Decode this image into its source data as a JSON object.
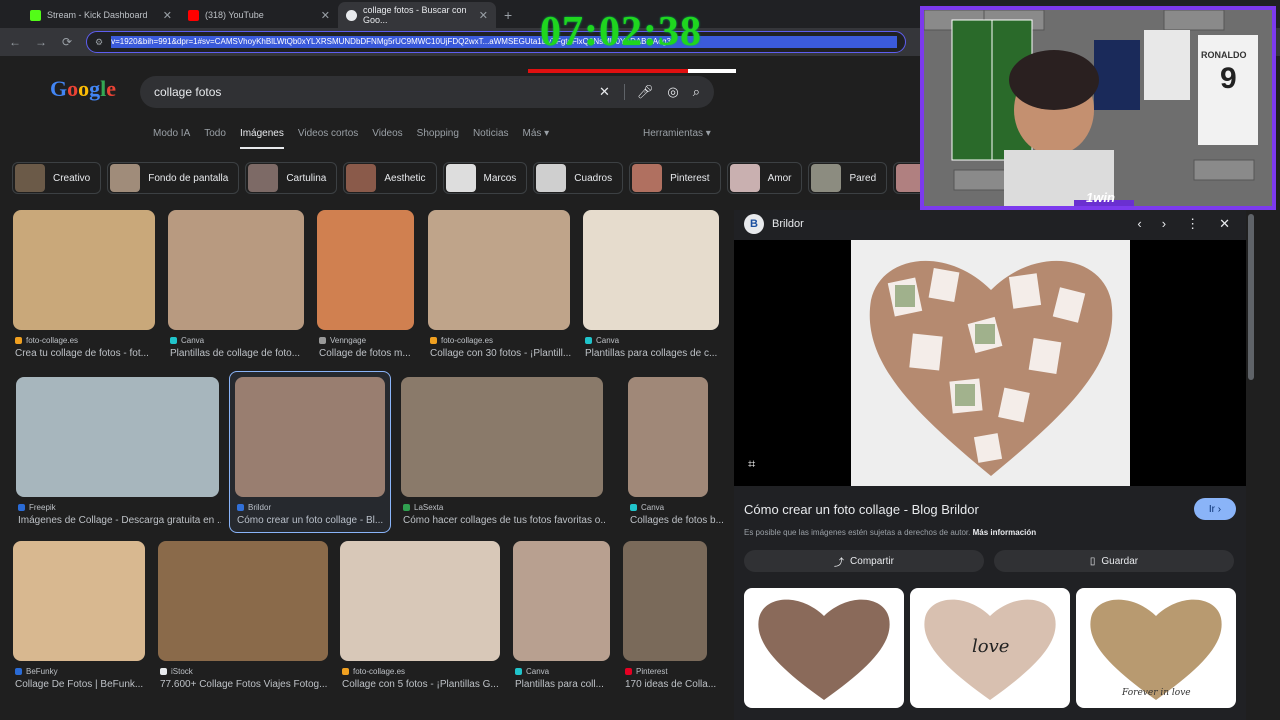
{
  "browser": {
    "tabs": [
      {
        "title": "Stream - Kick Dashboard",
        "favicon_color": "#53fc18"
      },
      {
        "title": "(318) YouTube",
        "favicon_color": "#ff0000"
      },
      {
        "title": "collage fotos - Buscar con Goo...",
        "favicon_color": "#e8eaed"
      }
    ],
    "url": "v=1920&bih=991&dpr=1#sv=CAMSVhoyKhBlLWtQb0xYLXRSMUNDbDFNMg5rUC9MWC10UjFDQ2wxT...aWMSEGUta1BvTFgtdFlxQ0NsMU0YADABGAcg3"
  },
  "overlay": {
    "timer": "07:02:38",
    "progress": 0.77
  },
  "search": {
    "logo": "Google",
    "query": "collage fotos"
  },
  "nav": {
    "tabs": [
      "Modo IA",
      "Todo",
      "Imágenes",
      "Videos cortos",
      "Videos",
      "Shopping",
      "Noticias",
      "Más ▾"
    ],
    "tools": "Herramientas ▾"
  },
  "chips": [
    {
      "label": "Creativo",
      "color": "#6b5a48"
    },
    {
      "label": "Fondo de pantalla",
      "color": "#a08c7a"
    },
    {
      "label": "Cartulina",
      "color": "#7d6a66"
    },
    {
      "label": "Aesthetic",
      "color": "#8a5a4a"
    },
    {
      "label": "Marcos",
      "color": "#dddddd"
    },
    {
      "label": "Cuadros",
      "color": "#cfcfcf"
    },
    {
      "label": "Pinterest",
      "color": "#b07060"
    },
    {
      "label": "Amor",
      "color": "#c9b0b0"
    },
    {
      "label": "Pared",
      "color": "#8c8c80"
    },
    {
      "label": "Cu",
      "color": "#b08080"
    }
  ],
  "results": [
    {
      "source": "foto-collage.es",
      "title": "Crea tu collage de fotos - fot...",
      "color": "#c9a87a",
      "src_color": "#f0a020"
    },
    {
      "source": "Canva",
      "title": "Plantillas de collage de foto...",
      "color": "#b89a80",
      "src_color": "#20c4cb"
    },
    {
      "source": "Venngage",
      "title": "Collage de fotos m...",
      "color": "#d08050",
      "src_color": "#999999"
    },
    {
      "source": "foto-collage.es",
      "title": "Collage con 30 fotos - ¡Plantill...",
      "color": "#bfa48a",
      "src_color": "#f0a020"
    },
    {
      "source": "Canva",
      "title": "Plantillas para collages de c...",
      "color": "#e6dccd",
      "src_color": "#20c4cb"
    },
    {
      "source": "Freepik",
      "title": "Imágenes de Collage - Descarga gratuita en ...",
      "color": "#a7b6bd",
      "src_color": "#2a6bd6"
    },
    {
      "source": "Brildor",
      "title": "Cómo crear un foto collage - Bl...",
      "color": "#9a7a66",
      "src_color": "#2a6bd6"
    },
    {
      "source": "LaSexta",
      "title": "Cómo hacer collages de tus fotos favoritas o...",
      "color": "#8a7a6a",
      "src_color": "#30a050"
    },
    {
      "source": "Canva",
      "title": "Collages de fotos b...",
      "color": "#a08878",
      "src_color": "#20c4cb"
    },
    {
      "source": "BeFunky",
      "title": "Collage De Fotos | BeFunk...",
      "color": "#d8b890",
      "src_color": "#2a6bd6"
    },
    {
      "source": "iStock",
      "title": "77.600+ Collage Fotos Viajes Fotog...",
      "color": "#8a6a4a",
      "src_color": "#e8eaed"
    },
    {
      "source": "foto-collage.es",
      "title": "Collage con 5 fotos - ¡Plantillas G...",
      "color": "#d8c8b8",
      "src_color": "#f0a020"
    },
    {
      "source": "Canva",
      "title": "Plantillas para coll...",
      "color": "#b8a090",
      "src_color": "#20c4cb"
    },
    {
      "source": "Pinterest",
      "title": "170 ideas de Colla...",
      "color": "#7a6a5a",
      "src_color": "#e60023"
    }
  ],
  "panel": {
    "source": "Brildor",
    "title": "Cómo crear un foto collage - Blog Brildor",
    "go": "Ir ›",
    "note": "Es posible que las imágenes estén sujetas a derechos de autor.",
    "more": "Más información",
    "share": "Compartir",
    "save": "Guardar",
    "thumb_text": "love",
    "thumb_text2": "Forever in love"
  },
  "webcam": {
    "jersey_name": "RONALDO",
    "jersey_number": "9",
    "sponsor": "1win"
  }
}
